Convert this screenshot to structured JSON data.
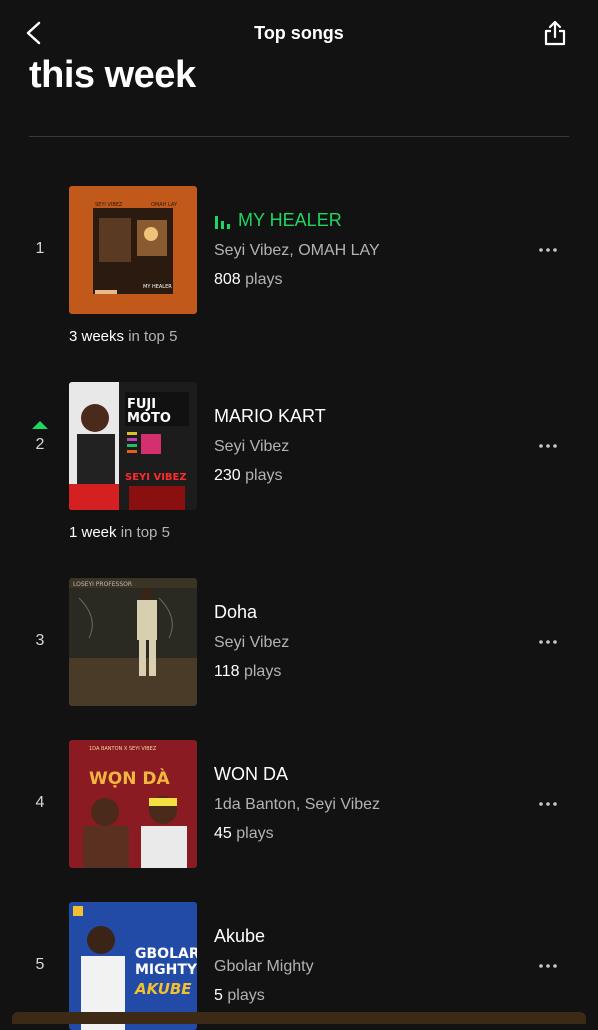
{
  "header": {
    "title": "Top songs",
    "heading": "this week"
  },
  "songs": [
    {
      "rank": "1",
      "title": "MY HEALER",
      "artist": "Seyi Vibez, OMAH LAY",
      "plays_num": "808",
      "plays_label": "plays",
      "weeks_num": "3 weeks",
      "weeks_label": "in top 5",
      "playing": true,
      "trend": "",
      "cover_text": "SEYI VIBEZ · OMAH LAY · MY HEALER",
      "cover_color": "#c0591a"
    },
    {
      "rank": "2",
      "title": "MARIO KART",
      "artist": "Seyi Vibez",
      "plays_num": "230",
      "plays_label": "plays",
      "weeks_num": "1 week",
      "weeks_label": "in top 5",
      "playing": false,
      "trend": "up",
      "cover_text": "FUJI MOTO · SEYI VIBEZ",
      "cover_color": "#1c1c1c"
    },
    {
      "rank": "3",
      "title": "Doha",
      "artist": "Seyi Vibez",
      "plays_num": "118",
      "plays_label": "plays",
      "playing": false,
      "trend": "",
      "cover_text": "LOSEYI PROFESSOR",
      "cover_color": "#3b3324"
    },
    {
      "rank": "4",
      "title": "WON DA",
      "artist": "1da Banton, Seyi Vibez",
      "plays_num": "45",
      "plays_label": "plays",
      "playing": false,
      "trend": "",
      "cover_text": "1DA BANTON X SEYI VIBEZ · WỌN DÀ",
      "cover_color": "#8b1b22"
    },
    {
      "rank": "5",
      "title": "Akube",
      "artist": "Gbolar Mighty",
      "plays_num": "5",
      "plays_label": "plays",
      "playing": false,
      "trend": "",
      "cover_text": "GBOLAR MIGHTY · AKUBE",
      "cover_color": "#1a3d8f"
    }
  ],
  "colors": {
    "background": "#121212",
    "accent": "#1ed760",
    "secondary_text": "#b3b3b3"
  },
  "icons": {
    "back": "chevron-left-icon",
    "share": "share-icon",
    "more": "more-horizontal-icon",
    "playing": "equalizer-icon",
    "trend": "arrow-up-icon"
  }
}
